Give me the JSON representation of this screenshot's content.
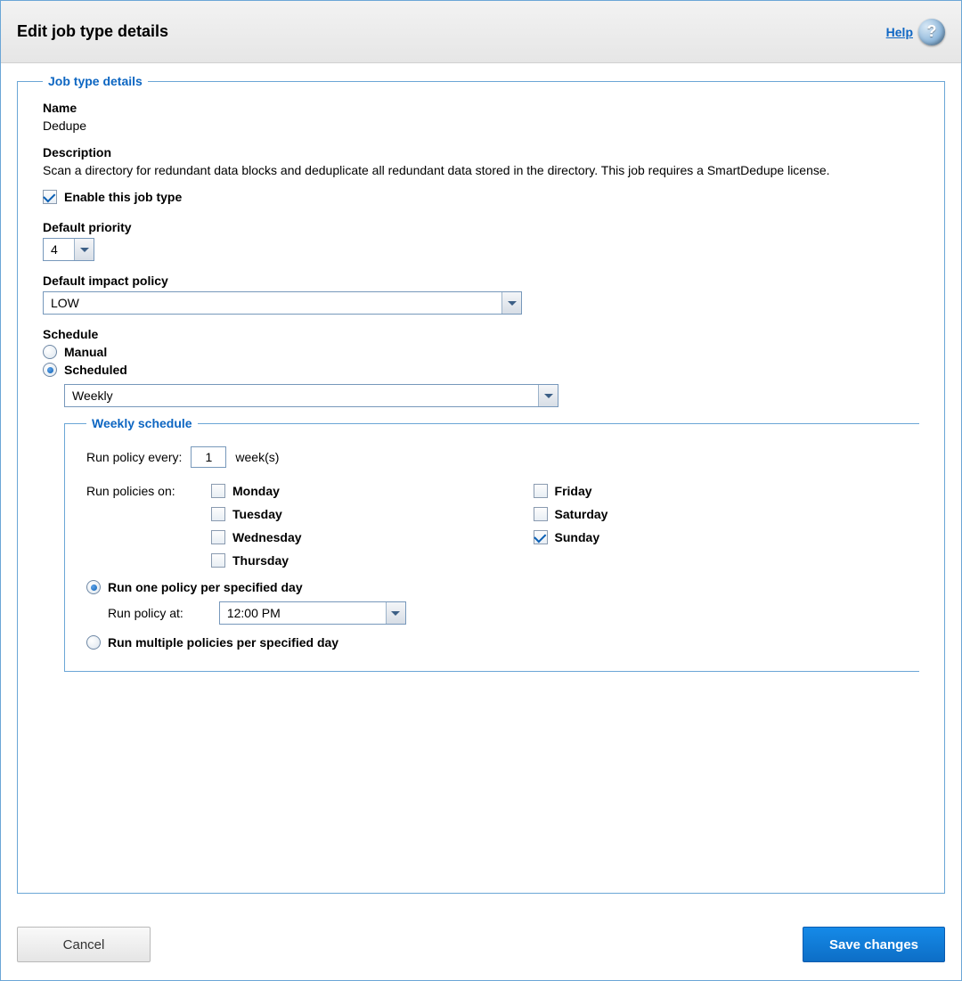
{
  "header": {
    "title": "Edit job type details",
    "help_label": "Help"
  },
  "fieldset": {
    "legend": "Job type details",
    "name_label": "Name",
    "name_value": "Dedupe",
    "description_label": "Description",
    "description_value": "Scan a directory for redundant data blocks and deduplicate all redundant data stored in the directory. This job requires a SmartDedupe license.",
    "enable_label": "Enable this job type",
    "enable_checked": true,
    "priority_label": "Default priority",
    "priority_value": "4",
    "impact_label": "Default impact policy",
    "impact_value": "LOW",
    "schedule_label": "Schedule",
    "schedule_manual_label": "Manual",
    "schedule_scheduled_label": "Scheduled",
    "schedule_mode": "scheduled",
    "frequency_value": "Weekly"
  },
  "weekly": {
    "legend": "Weekly schedule",
    "run_every_label": "Run policy every:",
    "run_every_value": "1",
    "run_every_units": "week(s)",
    "run_on_label": "Run policies on:",
    "days": {
      "monday": {
        "label": "Monday",
        "checked": false
      },
      "tuesday": {
        "label": "Tuesday",
        "checked": false
      },
      "wednesday": {
        "label": "Wednesday",
        "checked": false
      },
      "thursday": {
        "label": "Thursday",
        "checked": false
      },
      "friday": {
        "label": "Friday",
        "checked": false
      },
      "saturday": {
        "label": "Saturday",
        "checked": false
      },
      "sunday": {
        "label": "Sunday",
        "checked": true
      }
    },
    "run_one_label": "Run one policy per specified day",
    "run_multiple_label": "Run multiple policies per specified day",
    "policy_mode": "one",
    "run_at_label": "Run policy at:",
    "run_at_value": "12:00 PM"
  },
  "footer": {
    "cancel_label": "Cancel",
    "save_label": "Save changes"
  }
}
